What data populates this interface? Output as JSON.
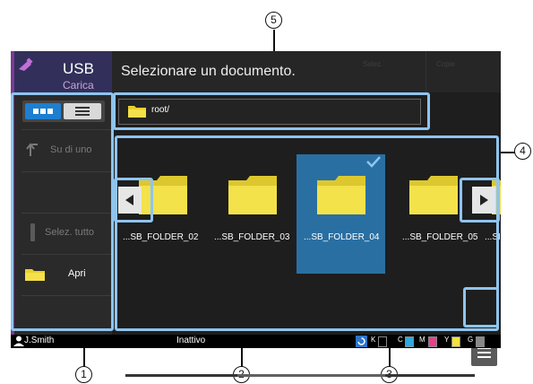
{
  "header": {
    "app_title": "USB",
    "app_subtitle": "Carica",
    "instruction": "Selezionare un documento.",
    "ghost_tab_1": "Selez.",
    "ghost_tab_2": "Copie"
  },
  "sidebar": {
    "view_toggle": {
      "selected": "thumbnails"
    },
    "up_level_label": "Su di uno",
    "select_all_label": "Selez. tutto",
    "open_label": "Apri"
  },
  "path": {
    "current": "root/"
  },
  "folders": [
    {
      "label": "...SB_FOLDER_02",
      "selected": false
    },
    {
      "label": "...SB_FOLDER_03",
      "selected": false
    },
    {
      "label": "...SB_FOLDER_04",
      "selected": true
    },
    {
      "label": "...SB_FOLDER_05",
      "selected": false
    },
    {
      "label": "...SI",
      "selected": false
    }
  ],
  "status_bar": {
    "user": "J.Smith",
    "state": "Inattivo",
    "toner": [
      {
        "label": "K",
        "level": 0.0,
        "color": "#111111"
      },
      {
        "label": "C",
        "level": 1.0,
        "color": "#2ea8df"
      },
      {
        "label": "M",
        "level": 1.0,
        "color": "#e2418c"
      },
      {
        "label": "Y",
        "level": 1.0,
        "color": "#f3e33b"
      },
      {
        "label": "G",
        "level": 1.0,
        "color": "#888888"
      }
    ]
  },
  "callouts": [
    "1",
    "2",
    "3",
    "4",
    "5"
  ],
  "colors": {
    "accent_purple": "#7a3b94",
    "highlight": "#8fc4ee",
    "selected_tile": "#2a6fa2",
    "folder_yellow": "#f0e24a"
  }
}
